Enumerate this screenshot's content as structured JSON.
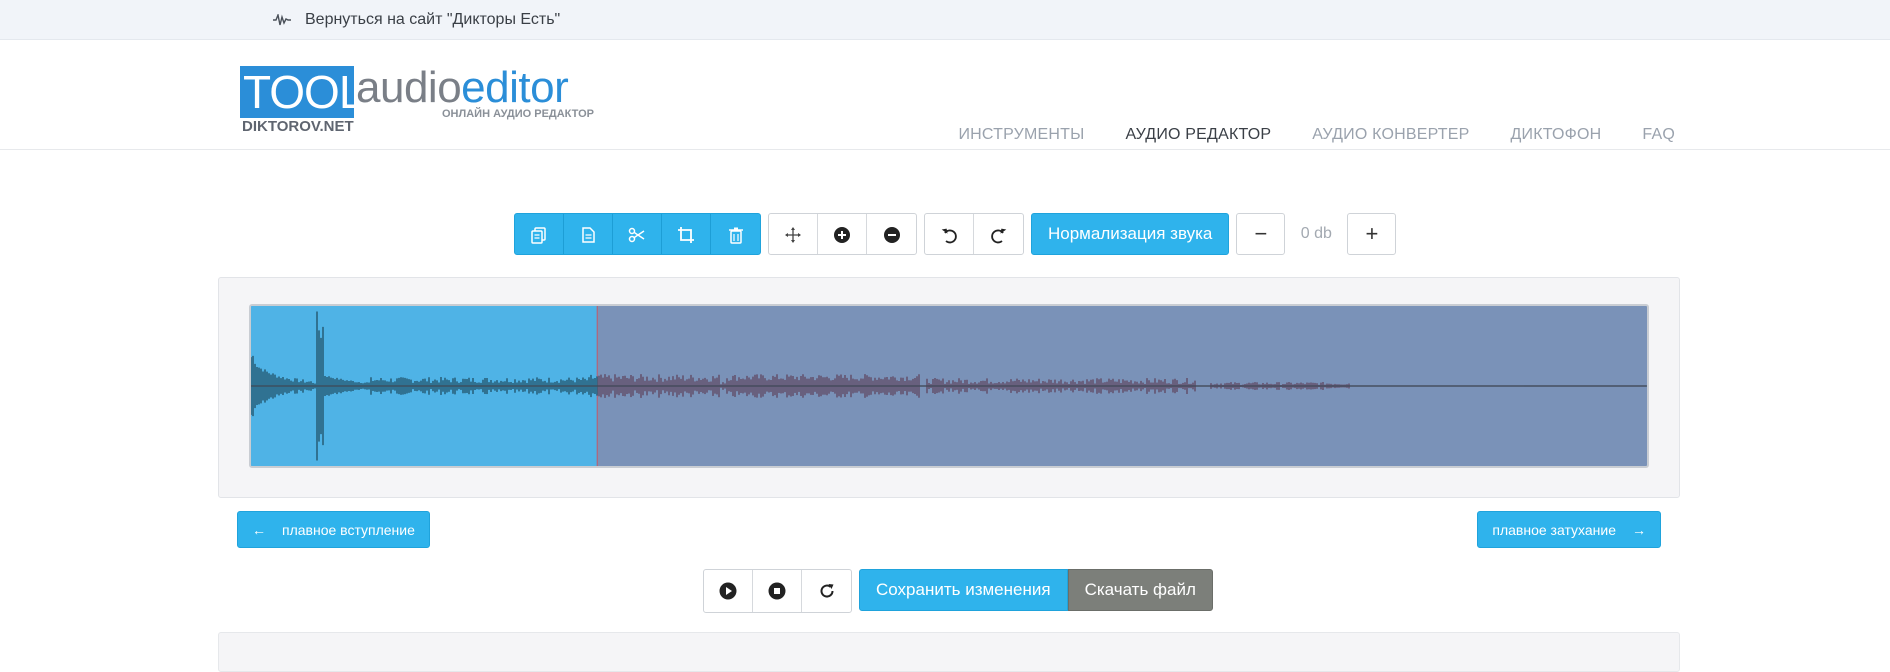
{
  "topbar": {
    "back_label": "Вернуться на сайт \"Дикторы Есть\""
  },
  "logo": {
    "box_text": "TOOLS.",
    "sub_left": "DIKTOROV.NET",
    "word_main": "audio",
    "word_accent": "editor",
    "tagline": "ОНЛАЙН АУДИО РЕДАКТОР"
  },
  "nav": {
    "items": [
      {
        "label": "ИНСТРУМЕНТЫ",
        "active": false
      },
      {
        "label": "АУДИО РЕДАКТОР",
        "active": true
      },
      {
        "label": "АУДИО КОНВЕРТЕР",
        "active": false
      },
      {
        "label": "ДИКТОФОН",
        "active": false
      },
      {
        "label": "FAQ",
        "active": false
      }
    ]
  },
  "toolbar": {
    "edit_icons": [
      "copy-icon",
      "paste-icon",
      "cut-icon",
      "crop-icon",
      "trash-icon"
    ],
    "view_icons": [
      "move-icon",
      "zoom-in-icon",
      "zoom-out-icon"
    ],
    "history_icons": [
      "undo-icon",
      "redo-icon"
    ],
    "normalize_label": "Нормализация звука",
    "db_minus": "−",
    "db_value": "0 db",
    "db_plus": "+"
  },
  "fade": {
    "in_label": "плавное вступление",
    "out_label": "плавное затухание"
  },
  "player": {
    "icons": [
      "play-icon",
      "stop-icon",
      "refresh-icon"
    ],
    "save_label": "Сохранить изменения",
    "download_label": "Скачать файл"
  },
  "colors": {
    "accent": "#2fb3ec",
    "selection": "#4fb3e6",
    "wave_bg": "#7a92b8",
    "download": "#7c7f7a"
  },
  "waveform": {
    "selection_fraction": 0.248
  }
}
